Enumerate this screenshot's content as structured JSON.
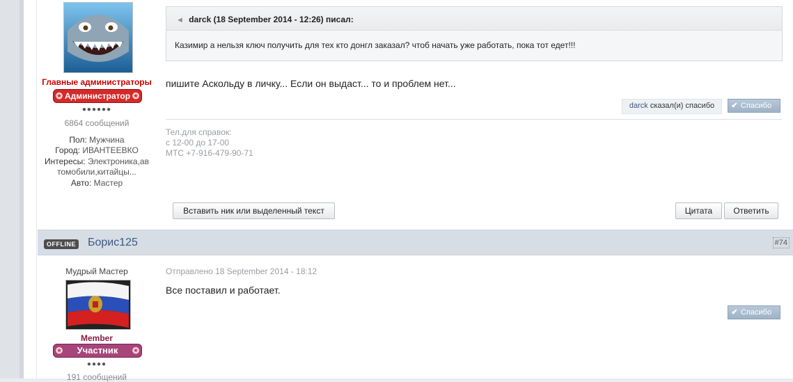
{
  "post1": {
    "group_title": "Главные администраторы",
    "badge_label": "Администратор",
    "rank_dots": "●●●●●●",
    "post_count": "6864 сообщений",
    "profile": [
      {
        "label": "Пол:",
        "value": "Мужчина"
      },
      {
        "label": "Город:",
        "value": "ИВАНТЕЕВКО"
      },
      {
        "label": "Интересы:",
        "value": "Электроника,ав"
      },
      {
        "label": "",
        "value": "томобили,китайцы..."
      },
      {
        "label": "Авто:",
        "value": "Мастер"
      }
    ],
    "quote_header": "darck (18 September 2014 - 12:26) писал:",
    "quote_text": "Казимир а нельзя ключ получить для тех кто донгл заказал? чтоб начать уже работать, пока тот едет!!!",
    "body_text": "пишите Аскольду в личку... Если он выдаст... то и проблем нет...",
    "thanks_user": "darck",
    "thanks_suffix": "сказал(и) спасибо",
    "thanks_button": "Спасибо",
    "signature": [
      "Тел.для справок:",
      "с 12-00 до 17-00",
      "МТС +7-916-479-90-71"
    ],
    "buttons": {
      "insert_nick": "Вставить ник или выделенный текст",
      "quote": "Цитата",
      "reply": "Ответить"
    }
  },
  "post2": {
    "status": "OFFLINE",
    "username": "Борис125",
    "post_number": "#74",
    "rank_name": "Мудрый Мастер",
    "group_title": "Member",
    "badge_label": "Участник",
    "rank_dots": "●●●●",
    "post_count": "191 сообщений",
    "posted": "Отправлено 18 September 2014 - 18:12",
    "body_text": "Все поставил и работает.",
    "thanks_button": "Спасибо"
  },
  "icons": {
    "quote_icon": "quote-arrow-icon",
    "thanks_icon": "checkmark-icon",
    "badge_star": "star-icon"
  },
  "colors": {
    "admin_red": "#cc0000",
    "member_purple": "#a8457a",
    "username_blue": "#3b5a82"
  }
}
